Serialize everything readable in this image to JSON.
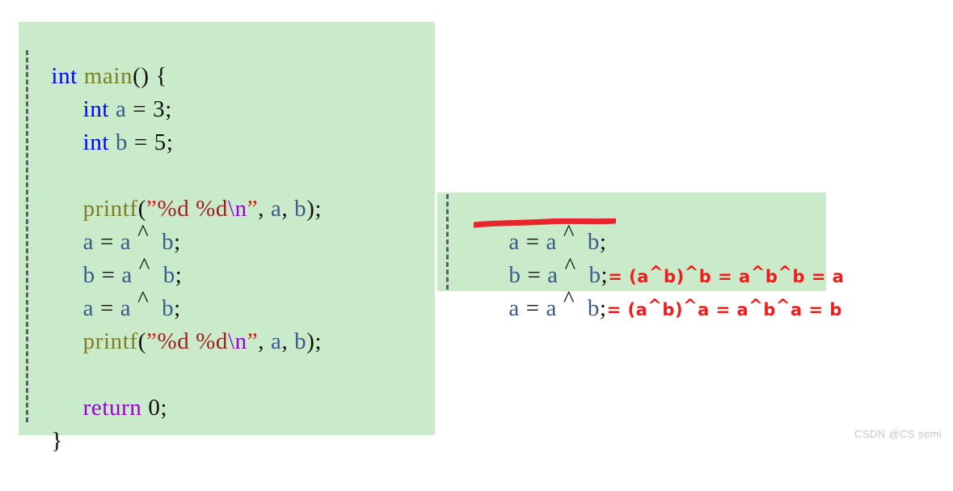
{
  "document": {
    "kind": "code-snippet-with-annotation",
    "background_color": "#ffffff",
    "code_block_color": "#c9ebc9"
  },
  "code_block": {
    "name": "c-source-main",
    "lines": [
      {
        "id": "line-1",
        "tokens": [
          {
            "text": "int",
            "kind": "keyword"
          },
          {
            "text": " ",
            "kind": "plain"
          },
          {
            "text": "main",
            "kind": "function"
          },
          {
            "text": "()",
            "kind": "punct"
          },
          {
            "text": " ",
            "kind": "plain"
          },
          {
            "text": "{",
            "kind": "punct"
          }
        ],
        "plain": "int main() {"
      },
      {
        "id": "line-2",
        "indent": 1,
        "tokens": [
          {
            "text": "int",
            "kind": "keyword"
          },
          {
            "text": " ",
            "kind": "plain"
          },
          {
            "text": "a",
            "kind": "var"
          },
          {
            "text": " = ",
            "kind": "punct"
          },
          {
            "text": "3",
            "kind": "number"
          },
          {
            "text": ";",
            "kind": "punct"
          }
        ],
        "plain": "    int a = 3;"
      },
      {
        "id": "line-3",
        "indent": 1,
        "tokens": [
          {
            "text": "int",
            "kind": "keyword"
          },
          {
            "text": " ",
            "kind": "plain"
          },
          {
            "text": "b",
            "kind": "var"
          },
          {
            "text": " = ",
            "kind": "punct"
          },
          {
            "text": "5",
            "kind": "number"
          },
          {
            "text": ";",
            "kind": "punct"
          }
        ],
        "plain": "    int b = 5;"
      },
      {
        "id": "line-4",
        "indent": 1,
        "tokens": [],
        "plain": ""
      },
      {
        "id": "line-5",
        "indent": 1,
        "tokens": [
          {
            "text": "printf",
            "kind": "function"
          },
          {
            "text": "(",
            "kind": "punct"
          },
          {
            "text": "”",
            "kind": "quote"
          },
          {
            "text": "%d",
            "kind": "format"
          },
          {
            "text": " ",
            "kind": "plain"
          },
          {
            "text": "%d",
            "kind": "format"
          },
          {
            "text": "\\n",
            "kind": "escape"
          },
          {
            "text": "”",
            "kind": "quote"
          },
          {
            "text": ", ",
            "kind": "punct"
          },
          {
            "text": "a",
            "kind": "var"
          },
          {
            "text": ", ",
            "kind": "punct"
          },
          {
            "text": "b",
            "kind": "var"
          },
          {
            "text": ");",
            "kind": "punct"
          }
        ],
        "plain": "    printf(”%d %d\\n”, a, b);"
      },
      {
        "id": "line-6",
        "indent": 1,
        "tokens": [
          {
            "text": "a",
            "kind": "var"
          },
          {
            "text": " = ",
            "kind": "punct"
          },
          {
            "text": "a",
            "kind": "var"
          },
          {
            "text": " ^ ",
            "kind": "operator"
          },
          {
            "text": "b",
            "kind": "var"
          },
          {
            "text": ";",
            "kind": "punct"
          }
        ],
        "plain": "    a = a ^ b;"
      },
      {
        "id": "line-7",
        "indent": 1,
        "tokens": [
          {
            "text": "b",
            "kind": "var"
          },
          {
            "text": " = ",
            "kind": "punct"
          },
          {
            "text": "a",
            "kind": "var"
          },
          {
            "text": " ^ ",
            "kind": "operator"
          },
          {
            "text": "b",
            "kind": "var"
          },
          {
            "text": ";",
            "kind": "punct"
          }
        ],
        "plain": "    b = a ^ b;"
      },
      {
        "id": "line-8",
        "indent": 1,
        "tokens": [
          {
            "text": "a",
            "kind": "var"
          },
          {
            "text": " = ",
            "kind": "punct"
          },
          {
            "text": "a",
            "kind": "var"
          },
          {
            "text": " ^ ",
            "kind": "operator"
          },
          {
            "text": "b",
            "kind": "var"
          },
          {
            "text": ";",
            "kind": "punct"
          }
        ],
        "plain": "    a = a ^ b;"
      },
      {
        "id": "line-9",
        "indent": 1,
        "tokens": [
          {
            "text": "printf",
            "kind": "function"
          },
          {
            "text": "(",
            "kind": "punct"
          },
          {
            "text": "”",
            "kind": "quote"
          },
          {
            "text": "%d",
            "kind": "format"
          },
          {
            "text": " ",
            "kind": "plain"
          },
          {
            "text": "%d",
            "kind": "format"
          },
          {
            "text": "\\n",
            "kind": "escape"
          },
          {
            "text": "”",
            "kind": "quote"
          },
          {
            "text": ", ",
            "kind": "punct"
          },
          {
            "text": "a",
            "kind": "var"
          },
          {
            "text": ", ",
            "kind": "punct"
          },
          {
            "text": "b",
            "kind": "var"
          },
          {
            "text": ");",
            "kind": "punct"
          }
        ],
        "plain": "    printf(”%d %d\\n”, a, b);"
      },
      {
        "id": "line-10",
        "indent": 1,
        "tokens": [],
        "plain": ""
      },
      {
        "id": "line-11",
        "indent": 1,
        "tokens": [
          {
            "text": "return",
            "kind": "return"
          },
          {
            "text": " ",
            "kind": "plain"
          },
          {
            "text": "0",
            "kind": "number"
          },
          {
            "text": ";",
            "kind": "punct"
          }
        ],
        "plain": "    return 0;"
      },
      {
        "id": "line-12",
        "tokens": [
          {
            "text": "}",
            "kind": "punct"
          }
        ],
        "plain": "}"
      }
    ]
  },
  "annotation_block": {
    "name": "xor-swap-explanation",
    "lines": [
      {
        "id": "annot-line-1",
        "code_plain": "a = a ^ b;",
        "code": {
          "lhs": "a",
          "eq": " = ",
          "rhs_a": "a",
          "caret": "^",
          "rhs_b": "b",
          "semi": ";"
        },
        "note": "",
        "underlined": true
      },
      {
        "id": "annot-line-2",
        "code_plain": "b = a ^ b;",
        "code": {
          "lhs": "b",
          "eq": " = ",
          "rhs_a": "a",
          "caret": "^",
          "rhs_b": "b",
          "semi": ";"
        },
        "note_segments": [
          "= ",
          "(a",
          "^",
          "b)",
          "^",
          "b",
          " = ",
          "a",
          "^",
          "b",
          "^",
          "b",
          " = ",
          "a"
        ],
        "note": "= (a^b)^b = a^b^b = a",
        "underlined": false
      },
      {
        "id": "annot-line-3",
        "code_plain": "a = a ^ b;",
        "code": {
          "lhs": "a",
          "eq": " = ",
          "rhs_a": "a",
          "caret": "^",
          "rhs_b": "b",
          "semi": ";"
        },
        "note_segments": [
          "= ",
          "(a",
          "^",
          "b)",
          "^",
          "a",
          " = ",
          "a",
          "^",
          "b",
          "^",
          "a",
          " = ",
          "b"
        ],
        "note": "= (a^b)^a = a^b^a = b",
        "underlined": false
      }
    ],
    "annotation_color": "#f01c1c",
    "underline": {
      "name": "red-highlight-underline",
      "color": "#e8252a",
      "target_line": "annot-line-1"
    }
  },
  "watermark": {
    "text": "CSDN @CS semi",
    "color": "#c7c7c7"
  }
}
